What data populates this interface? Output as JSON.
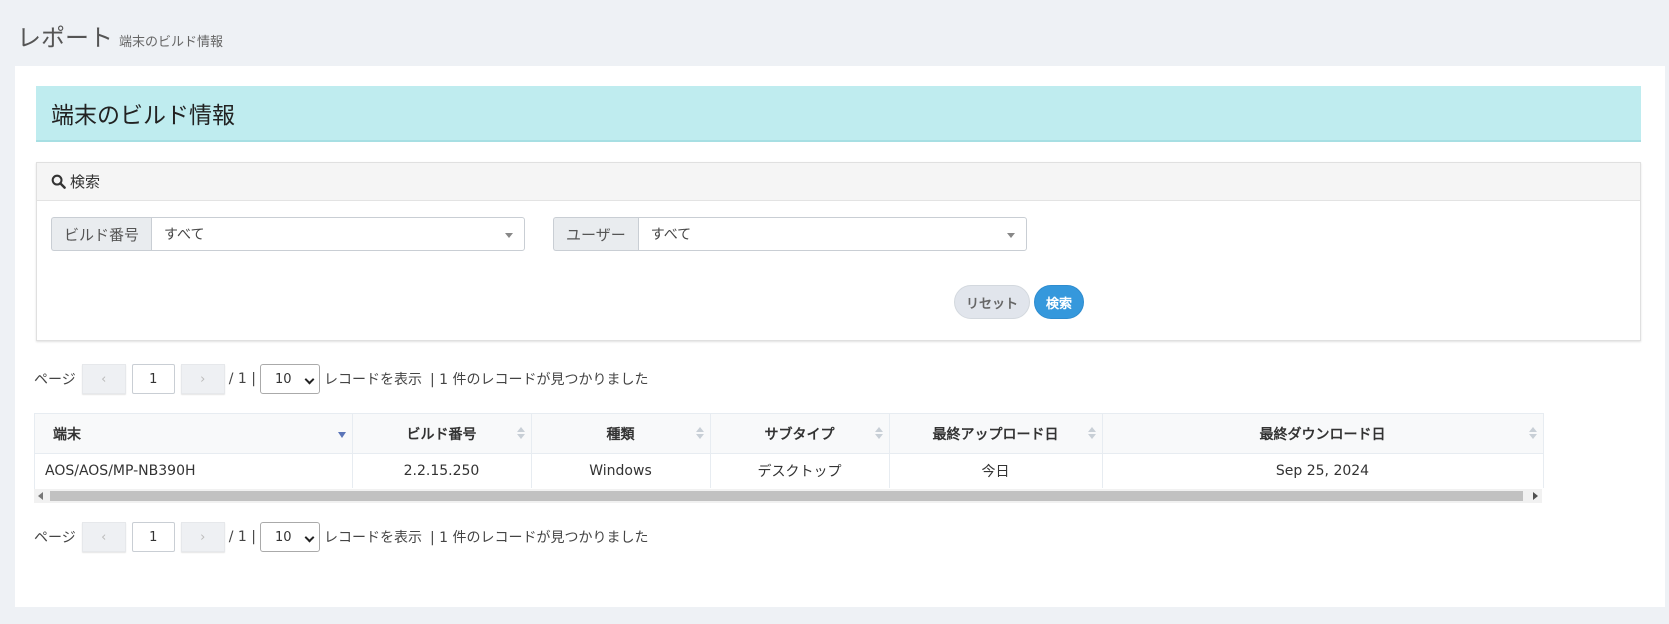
{
  "header": {
    "title": "レポート",
    "subtitle": "端末のビルド情報"
  },
  "banner": {
    "title": "端末のビルド情報"
  },
  "search": {
    "heading": "検索",
    "build_label": "ビルド番号",
    "build_value": "すべて",
    "user_label": "ユーザー",
    "user_value": "すべて",
    "reset_label": "リセット",
    "submit_label": "検索"
  },
  "pager": {
    "page_label": "ページ",
    "prev": "‹",
    "next": "›",
    "current": "1",
    "total": "/ 1 |",
    "page_size": "10",
    "show_label": "レコードを表示",
    "found": "| 1 件のレコードが見つかりました"
  },
  "table": {
    "columns": [
      "端末",
      "ビルド番号",
      "種類",
      "サブタイプ",
      "最終アップロード日",
      "最終ダウンロード日"
    ],
    "rows": [
      [
        "AOS/AOS/MP-NB390H",
        "2.2.15.250",
        "Windows",
        "デスクトップ",
        "今日",
        "Sep 25, 2024"
      ]
    ]
  }
}
